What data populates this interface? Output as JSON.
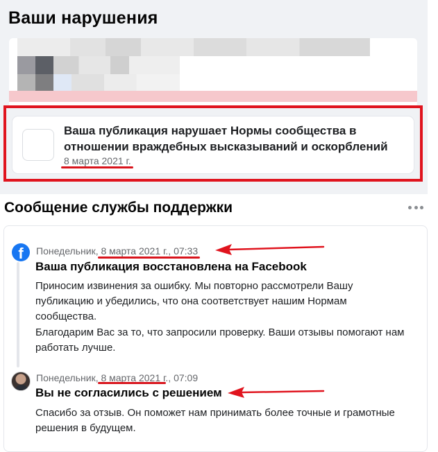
{
  "violations": {
    "title": "Ваши нарушения",
    "item": {
      "text": "Ваша публикация нарушает Нормы сообщества в отношении враждебных высказываний и оскорблений",
      "date": "8 марта 2021 г."
    }
  },
  "support": {
    "title": "Сообщение службы поддержки",
    "messages": [
      {
        "meta_prefix": "Понедельник, ",
        "meta_date": "8 марта 2021 г.",
        "meta_time": ", 07:33",
        "heading": "Ваша публикация восстановлена на Facebook",
        "body": [
          "Приносим извинения за ошибку. Мы повторно рассмотрели Вашу публикацию и убедились, что она соответствует нашим Нормам сообщества.",
          "Благодарим Вас за то, что запросили проверку. Ваши отзывы помогают нам работать лучше."
        ]
      },
      {
        "meta_prefix": "Понедельник, ",
        "meta_date": "8 марта 2021 г.",
        "meta_time": ", 07:09",
        "heading": "Вы не согласились с решением",
        "body": [
          "Спасибо за отзыв. Он поможет нам принимать более точные и грамотные решения в будущем."
        ]
      }
    ]
  },
  "icons": {
    "more": "more-options-icon",
    "facebook": "facebook-logo-icon",
    "avatar": "user-avatar"
  },
  "colors": {
    "highlight": "#e0141e",
    "facebook_blue": "#1877f2",
    "secondary_text": "#65676b"
  }
}
